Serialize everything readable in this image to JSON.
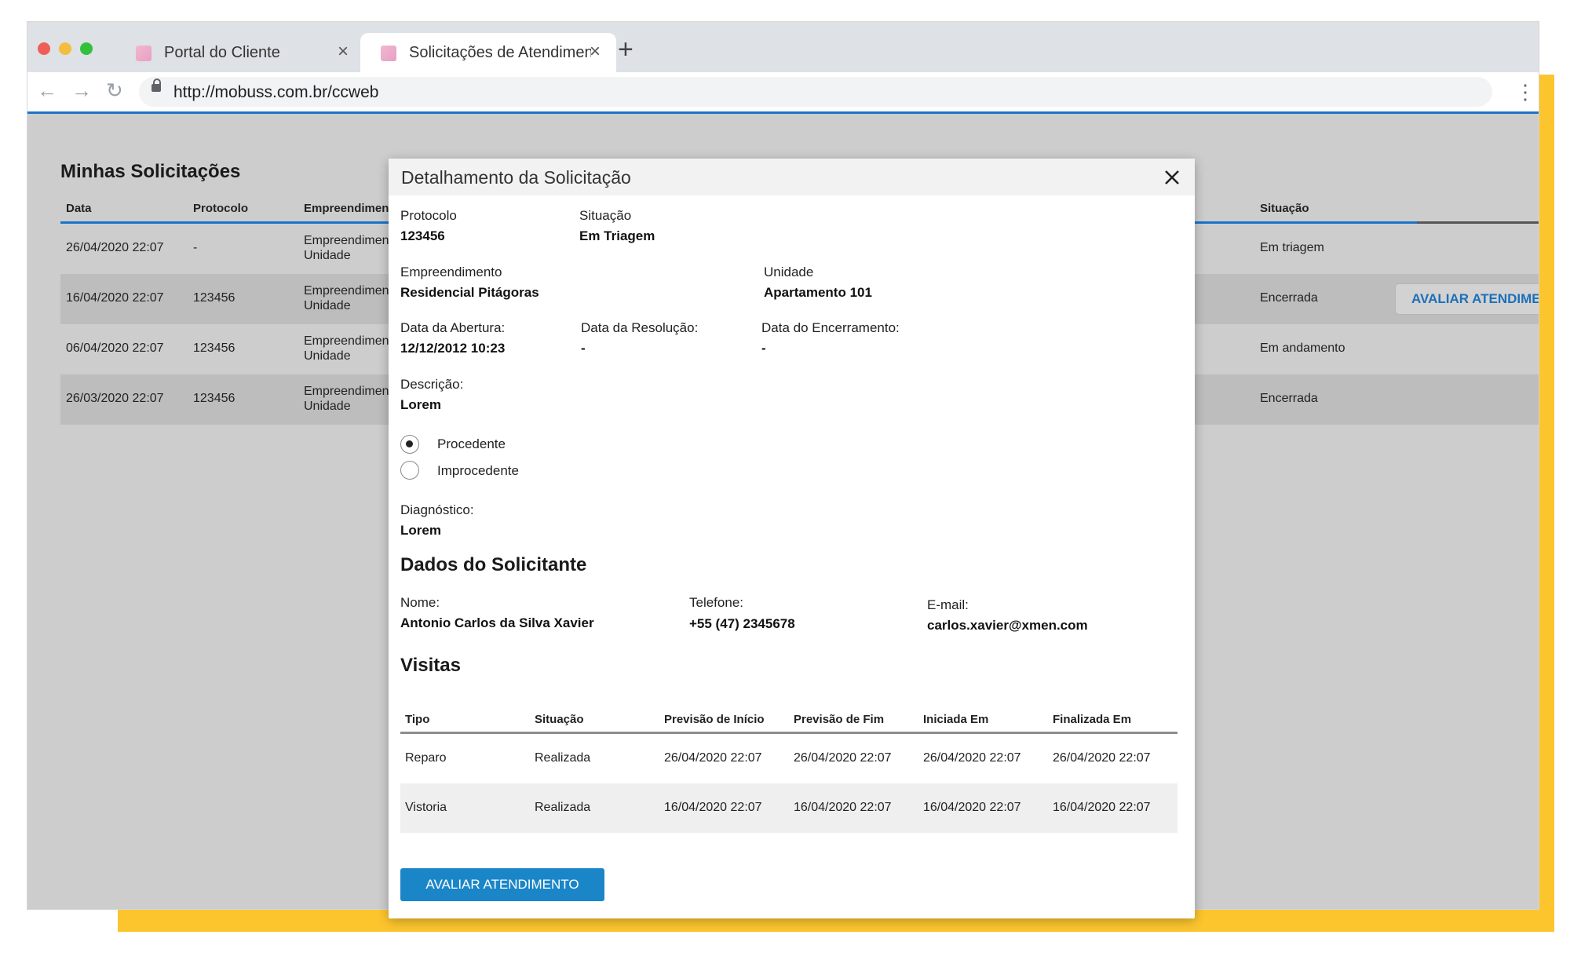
{
  "browser": {
    "tabs": [
      {
        "title": "Portal do Cliente",
        "close": "×"
      },
      {
        "title": "Solicitações de Atendimento",
        "close": "×"
      }
    ],
    "new_tab": "+",
    "url": "http://mobuss.com.br/ccweb",
    "nav": {
      "back": "←",
      "forward": "→",
      "reload": "↻",
      "menu": "⋮"
    },
    "traffic_lights": {
      "close": "#ee5e57",
      "minimize": "#f5bd3f",
      "maximize": "#32c13c"
    }
  },
  "page": {
    "title": "Minhas Solicitações",
    "columns": [
      "Data",
      "Protocolo",
      "Empreendimento",
      "Situação"
    ],
    "rows": [
      {
        "data": "26/04/2020 22:07",
        "protocolo": "-",
        "emp1": "Empreendimento",
        "emp2": "Unidade",
        "situacao": "Em triagem"
      },
      {
        "data": "16/04/2020 22:07",
        "protocolo": "123456",
        "emp1": "Empreendimento",
        "emp2": "Unidade",
        "situacao": "Encerrada",
        "action": "AVALIAR ATENDIMENTO"
      },
      {
        "data": "06/04/2020 22:07",
        "protocolo": "123456",
        "emp1": "Empreendimento",
        "emp2": "Unidade",
        "situacao": "Em andamento"
      },
      {
        "data": "26/03/2020 22:07",
        "protocolo": "123456",
        "emp1": "Empreendimento",
        "emp2": "Unidade",
        "situacao": "Encerrada"
      }
    ]
  },
  "modal": {
    "title": "Detalhamento da Solicitação",
    "protocolo": {
      "label": "Protocolo",
      "value": "123456"
    },
    "situacao": {
      "label": "Situação",
      "value": "Em Triagem"
    },
    "empreendimento": {
      "label": "Empreendimento",
      "value": "Residencial Pitágoras"
    },
    "unidade": {
      "label": "Unidade",
      "value": "Apartamento 101"
    },
    "abertura": {
      "label": "Data da Abertura:",
      "value": "12/12/2012 10:23"
    },
    "resolucao": {
      "label": "Data da Resolução:",
      "value": "-"
    },
    "encerramento": {
      "label": "Data do Encerramento:",
      "value": "-"
    },
    "descricao": {
      "label": "Descrição:",
      "value": "Lorem"
    },
    "options": [
      {
        "label": "Procedente",
        "selected": true
      },
      {
        "label": "Improcedente",
        "selected": false
      }
    ],
    "diagnostico": {
      "label": "Diagnóstico:",
      "value": "Lorem"
    },
    "solicitante": {
      "title": "Dados do Solicitante",
      "nome": {
        "label": "Nome:",
        "value": "Antonio Carlos da Silva Xavier"
      },
      "telefone": {
        "label": "Telefone:",
        "value": "+55 (47) 2345678"
      },
      "email": {
        "label": "E-mail:",
        "value": "carlos.xavier@xmen.com"
      }
    },
    "visitas": {
      "title": "Visitas",
      "columns": [
        "Tipo",
        "Situação",
        "Previsão de Início",
        "Previsão de Fim",
        "Iniciada Em",
        "Finalizada Em"
      ],
      "rows": [
        [
          "Reparo",
          "Realizada",
          "26/04/2020 22:07",
          "26/04/2020 22:07",
          "26/04/2020 22:07",
          "26/04/2020 22:07"
        ],
        [
          "Vistoria",
          "Realizada",
          "16/04/2020 22:07",
          "16/04/2020 22:07",
          "16/04/2020 22:07",
          "16/04/2020 22:07"
        ]
      ]
    },
    "action_button": "AVALIAR ATENDIMENTO"
  },
  "colors": {
    "accent": "#1a86c8",
    "highlight": "#fcc52e",
    "overlay": "#cdcdcd"
  }
}
